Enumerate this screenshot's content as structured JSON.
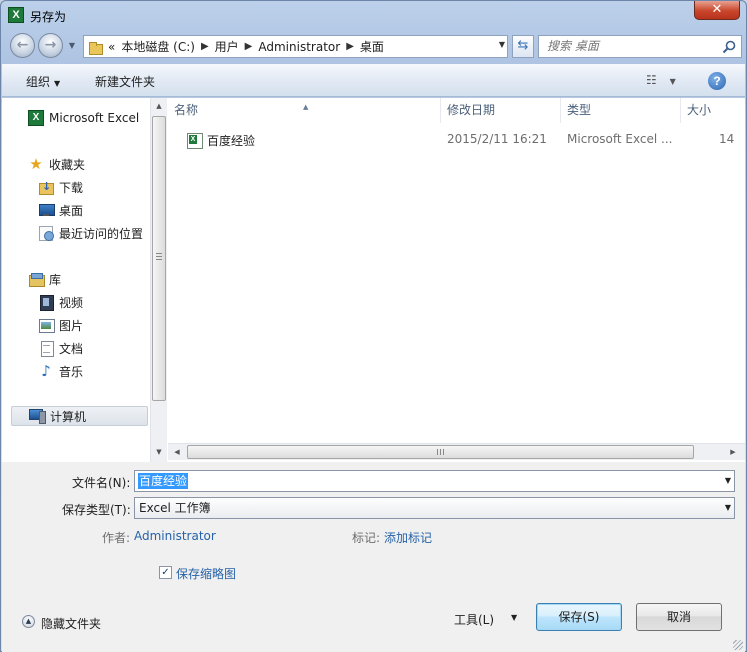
{
  "window": {
    "title": "另存为",
    "close_label": "✕"
  },
  "nav": {
    "breadcrumb_prefix": "«",
    "breadcrumb": [
      "本地磁盘 (C:)",
      "用户",
      "Administrator",
      "桌面"
    ],
    "search_placeholder": "搜索 桌面"
  },
  "toolbar": {
    "organize_label": "组织",
    "new_folder_label": "新建文件夹"
  },
  "sidebar": {
    "items": [
      {
        "label": "Microsoft Excel",
        "icon": "excel-icon"
      },
      {
        "label": "收藏夹",
        "icon": "star-icon"
      },
      {
        "label": "下载",
        "icon": "downloads-folder-icon"
      },
      {
        "label": "桌面",
        "icon": "desktop-icon"
      },
      {
        "label": "最近访问的位置",
        "icon": "recent-places-icon"
      },
      {
        "label": "库",
        "icon": "libraries-icon"
      },
      {
        "label": "视频",
        "icon": "videos-icon"
      },
      {
        "label": "图片",
        "icon": "pictures-icon"
      },
      {
        "label": "文档",
        "icon": "documents-icon"
      },
      {
        "label": "音乐",
        "icon": "music-icon"
      },
      {
        "label": "计算机",
        "icon": "computer-icon"
      }
    ]
  },
  "file_list": {
    "columns": [
      "名称",
      "修改日期",
      "类型",
      "大小"
    ],
    "rows": [
      {
        "name": "百度经验",
        "modified": "2015/2/11 16:21",
        "type": "Microsoft Excel ...",
        "size": "14 "
      }
    ]
  },
  "form": {
    "filename_label": "文件名(N):",
    "filename_value": "百度经验",
    "filetype_label": "保存类型(T):",
    "filetype_value": "Excel 工作簿",
    "author_label": "作者:",
    "author_value": "Administrator",
    "tags_label": "标记:",
    "tags_value": "添加标记",
    "thumbnail_label": "保存缩略图",
    "thumbnail_checked": true,
    "hide_folders_label": "隐藏文件夹",
    "tools_label": "工具(L)",
    "save_label": "保存(S)",
    "cancel_label": "取消"
  },
  "colors": {
    "accent": "#3399ff",
    "link": "#2562a8",
    "close": "#c8462c"
  }
}
